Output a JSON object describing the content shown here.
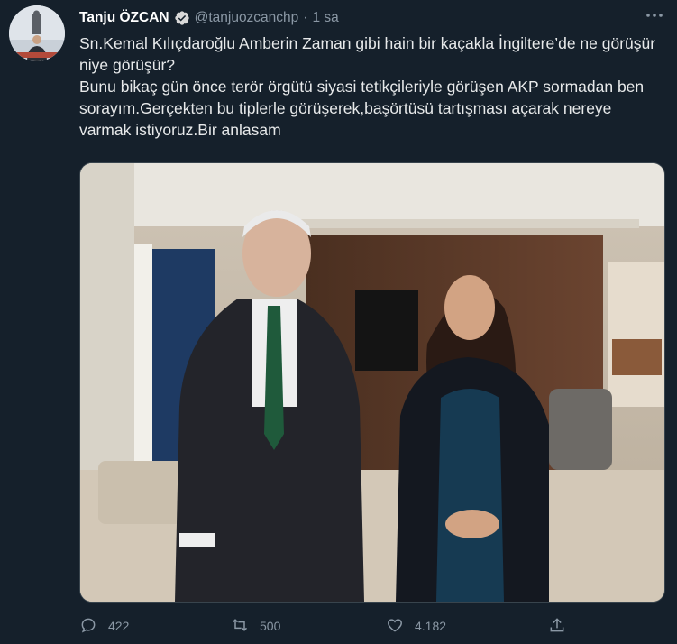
{
  "author": {
    "name": "Tanju ÖZCAN",
    "handle": "@tanjuozcanchp",
    "separator": "·",
    "time": "1 sa"
  },
  "icons": {
    "verified": "verified-badge-icon",
    "more": "more-options-icon",
    "reply": "reply-icon",
    "retweet": "retweet-icon",
    "like": "heart-icon",
    "share": "share-icon"
  },
  "tweet": {
    "line1": "Sn.Kemal Kılıçdaroğlu Amberin Zaman gibi hain bir kaçakla İngiltere’de ne görüşür niye görüşür?",
    "line2": "Bunu bikaç gün önce terör örgütü siyasi tetikçileriyle görüşen AKP sormadan ben sorayım.Gerçekten bu tiplerle görüşerek,başörtüsü tartışması açarak nereye varmak istiyoruz.Bir anlasam"
  },
  "actions": {
    "replies": "422",
    "retweets": "500",
    "likes": "4.182"
  },
  "colors": {
    "background": "#15202b",
    "text": "#e7e9ea",
    "muted": "#8b98a5",
    "verified": "#d9d9d9"
  }
}
